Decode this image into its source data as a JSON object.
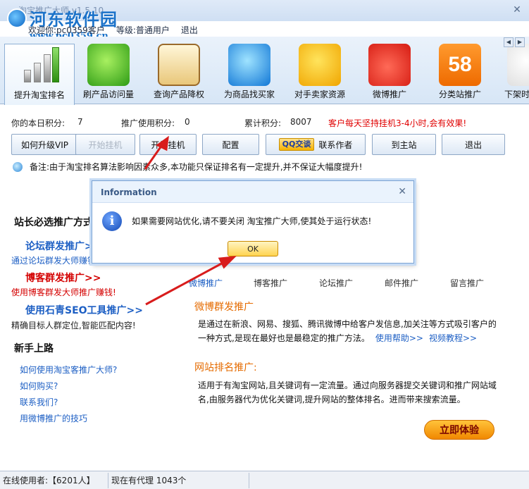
{
  "window": {
    "title": "淘宝推广大师 v1.5.10",
    "watermark_text": "河东软件园",
    "watermark_url": "www.pc0359.cn"
  },
  "user_bar": {
    "welcome": "欢迎你:pc0359客户",
    "level": "等级:普通用户",
    "logout": "退出"
  },
  "toolbar": {
    "items": [
      {
        "label": "提升淘宝排名",
        "icon": "bar-chart-icon"
      },
      {
        "label": "刷产品访问量",
        "icon": "recycle-icon"
      },
      {
        "label": "查询产品降权",
        "icon": "clipboard-icon"
      },
      {
        "label": "为商品找买家",
        "icon": "qq-icon"
      },
      {
        "label": "对手卖家资源",
        "icon": "sunglasses-face-icon"
      },
      {
        "label": "微博推广",
        "icon": "weibo-icon"
      },
      {
        "label": "分类站推广",
        "icon": "58-icon",
        "icon_text": "58"
      },
      {
        "label": "下架时",
        "icon": "download-icon"
      }
    ]
  },
  "stats": {
    "today_label": "你的本日积分:",
    "today_value": "7",
    "promo_label": "推广使用积分:",
    "promo_value": "0",
    "total_label": "累计积分:",
    "total_value": "8007",
    "tip": "客户每天坚持挂机3-4小时,会有效果!"
  },
  "actions": {
    "upgrade": "如何升级VIP",
    "stop": "开始挂机",
    "start": "开始挂机",
    "config": "配置",
    "qq_badge": "QQ交谈",
    "contact": "联系作者",
    "home": "到主站",
    "exit": "退出"
  },
  "note": "备注:由于淘宝排名算法影响因素众多,本功能只保证排名有一定提升,并不保证大幅度提升!",
  "left_panel": {
    "title": "站长必选推广方式",
    "links": [
      {
        "title": "论坛群发推广>",
        "desc": "通过论坛群发大师赚钱"
      },
      {
        "title": "博客群发推广>>",
        "desc": "使用博客群发大师推广赚钱!"
      },
      {
        "title": "使用石青SEO工具推广>>",
        "desc": "精确目标人群定位,智能匹配内容!"
      }
    ],
    "new_title": "新手上路",
    "new_links": [
      "如何使用淘宝客推广大师?",
      "如何购买?",
      "联系我们?",
      "用微博推广的技巧"
    ]
  },
  "tabs": [
    "微博推广",
    "博客推广",
    "论坛推广",
    "邮件推广",
    "留言推广"
  ],
  "sections": [
    {
      "title": "微博群发推广",
      "text": "是通过在新浪、网易、搜狐、腾讯微博中给客户发信息,加关注等方式吸引客户的一种方式,是现在最好也是最稳定的推广方法。",
      "links": [
        "使用帮助>>",
        "视频教程>>"
      ]
    },
    {
      "title": "网站排名推广:",
      "text": "适用于有淘宝网站,且关键词有一定流量。通过向服务器提交关键词和推广网站域名,由服务器代为优化关键词,提升网站的整体排名。进而带来搜索流量。"
    }
  ],
  "cta": "立即体验",
  "status": {
    "online": "在线使用者:【6201人】",
    "agents": "现在有代理 1043个"
  },
  "dialog": {
    "title": "Information",
    "message": "如果需要网站优化,请不要关闭 淘宝推广大师,使其处于运行状态!",
    "ok": "OK"
  },
  "colors": {
    "accent_red": "#e00000",
    "link_blue": "#1d5fc4",
    "section_orange": "#e56b00",
    "cta_orange": "#f18800",
    "annotation_arrow": "#d81c1c"
  }
}
